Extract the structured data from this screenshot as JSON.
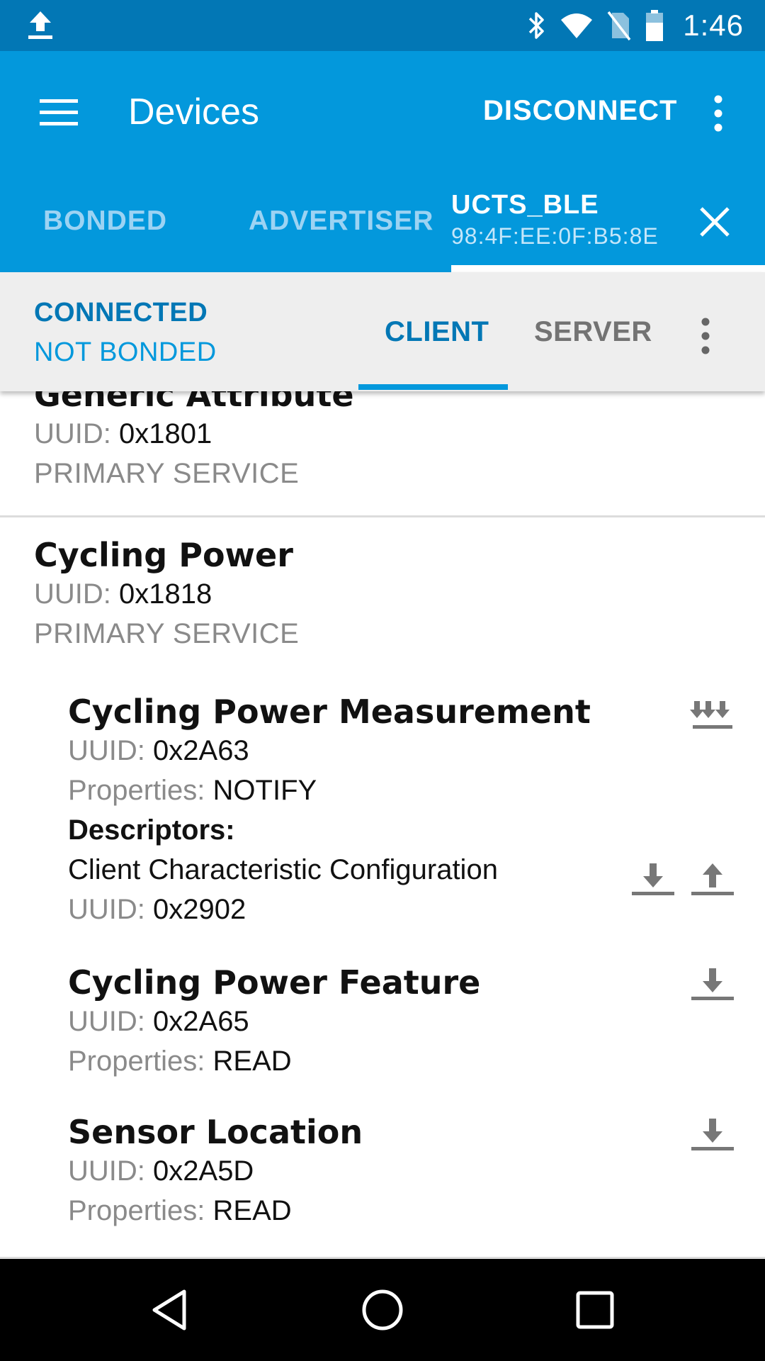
{
  "status_bar": {
    "time": "1:46",
    "icons": [
      "upload-icon",
      "bluetooth-icon",
      "wifi-icon",
      "no-sim-icon",
      "battery-icon"
    ]
  },
  "app_bar": {
    "title": "Devices",
    "disconnect_label": "DISCONNECT",
    "tabs": [
      {
        "label": "BONDED"
      },
      {
        "label": "ADVERTISER"
      }
    ],
    "device_tab": {
      "name": "UCTS_BLE",
      "mac": "98:4F:EE:0F:B5:8E"
    }
  },
  "sub_header": {
    "connection_status": "CONNECTED",
    "bond_status": "NOT BONDED",
    "tabs": [
      {
        "label": "CLIENT"
      },
      {
        "label": "SERVER"
      }
    ]
  },
  "labels": {
    "uuid": "UUID:",
    "properties": "Properties:",
    "descriptors": "Descriptors:"
  },
  "services": [
    {
      "name": "Generic Attribute",
      "uuid": "0x1801",
      "type": "PRIMARY SERVICE"
    },
    {
      "name": "Cycling Power",
      "uuid": "0x1818",
      "type": "PRIMARY SERVICE",
      "characteristics": [
        {
          "name": "Cycling Power Measurement",
          "uuid": "0x2A63",
          "properties": "NOTIFY",
          "descriptors": [
            {
              "name": "Client Characteristic Configuration",
              "uuid": "0x2902"
            }
          ]
        },
        {
          "name": "Cycling Power Feature",
          "uuid": "0x2A65",
          "properties": "READ"
        },
        {
          "name": "Sensor Location",
          "uuid": "0x2A5D",
          "properties": "READ"
        }
      ]
    }
  ],
  "colors": {
    "status_bar": "#0277b5",
    "app_bar": "#0398dc",
    "accent": "#0277b5"
  }
}
